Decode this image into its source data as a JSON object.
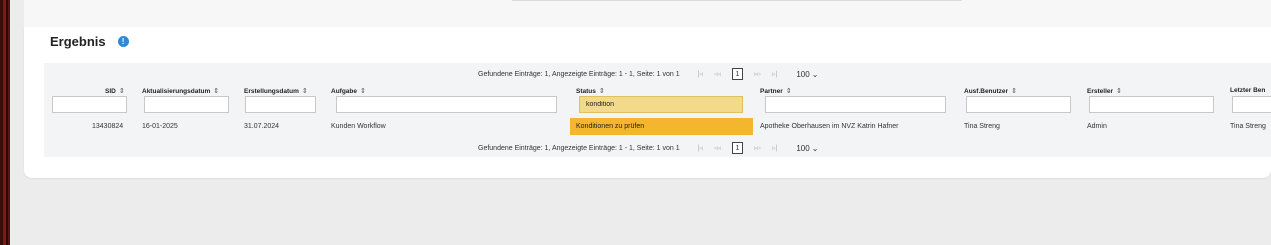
{
  "section": {
    "title": "Ergebnis",
    "info_icon": "info-icon",
    "info_glyph": "!"
  },
  "pager_top": {
    "info": "Gefundene Einträge: 1, Angezeigte Einträge: 1 - 1, Seite: 1 von 1",
    "first": "|◃",
    "prev": "◃◃",
    "current": "1",
    "next": "▹▹",
    "last": "▹|",
    "page_size": "100",
    "chevron": "⌄"
  },
  "pager_bottom": {
    "info": "Gefundene Einträge: 1, Angezeigte Einträge: 1 - 1, Seite: 1 von 1",
    "first": "|◃",
    "prev": "◃◃",
    "current": "1",
    "next": "▹▹",
    "last": "▹|",
    "page_size": "100",
    "chevron": "⌄"
  },
  "columns": [
    {
      "key": "sid",
      "label": "SID",
      "filter": ""
    },
    {
      "key": "aktualisierungsdatum",
      "label": "Aktualisierungsdatum",
      "filter": ""
    },
    {
      "key": "erstellungsdatum",
      "label": "Erstellungsdatum",
      "filter": ""
    },
    {
      "key": "aufgabe",
      "label": "Aufgabe",
      "filter": ""
    },
    {
      "key": "status",
      "label": "Status",
      "filter": "kondition"
    },
    {
      "key": "partner",
      "label": "Partner",
      "filter": ""
    },
    {
      "key": "ausf_benutzer",
      "label": "Ausf.Benutzer",
      "filter": ""
    },
    {
      "key": "ersteller",
      "label": "Ersteller",
      "filter": ""
    },
    {
      "key": "letzter_benutzer",
      "label": "Letzter Ben",
      "filter": ""
    }
  ],
  "sort_glyph": "⇕",
  "rows": [
    {
      "sid": "13430824",
      "aktualisierungsdatum": "16-01-2025",
      "erstellungsdatum": "31.07.2024",
      "aufgabe": "Kunden Workflow",
      "status": "Konditionen zu prüfen",
      "partner": "Apotheke Oberhausen im NVZ Katrin Hafner",
      "ausf_benutzer": "Tina Streng",
      "ersteller": "Admin",
      "letzter_benutzer": "Tina Streng"
    }
  ],
  "colors": {
    "status_highlight": "#f3b62e",
    "filter_active": "#f3d98a",
    "info_blue": "#2c8ad8"
  }
}
